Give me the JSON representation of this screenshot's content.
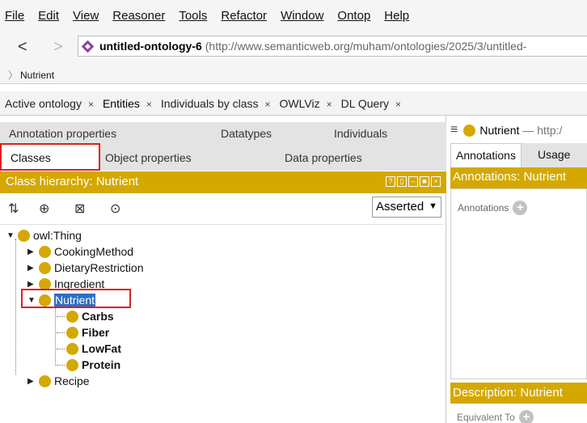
{
  "menu": [
    "File",
    "Edit",
    "View",
    "Reasoner",
    "Tools",
    "Refactor",
    "Window",
    "Ontop",
    "Help"
  ],
  "nav": {
    "back": "<",
    "forward": ">",
    "ontology_name": "untitled-ontology-6",
    "ontology_iri": "(http://www.semanticweb.org/muham/ontologies/2025/3/untitled-",
    "breadcrumb": "Nutrient"
  },
  "tabs": [
    {
      "label": "Active ontology",
      "close": "×"
    },
    {
      "label": "Entities",
      "close": "×"
    },
    {
      "label": "Individuals by class",
      "close": "×"
    },
    {
      "label": "OWLViz",
      "close": "×"
    },
    {
      "label": "DL Query",
      "close": "×"
    }
  ],
  "subtabs": {
    "annotation_properties": "Annotation properties",
    "datatypes": "Datatypes",
    "individuals": "Individuals",
    "classes": "Classes",
    "object_properties": "Object properties",
    "data_properties": "Data properties"
  },
  "hierarchy": {
    "title": "Class hierarchy: Nutrient",
    "mode": "Asserted",
    "nodes": {
      "root": "owl:Thing",
      "cooking": "CookingMethod",
      "dietary": "DietaryRestriction",
      "ingredient": "Ingredient",
      "nutrient": "Nutrient",
      "carbs": "Carbs",
      "fiber": "Fiber",
      "lowfat": "LowFat",
      "protein": "Protein",
      "recipe": "Recipe"
    }
  },
  "right_panel": {
    "entity": "Nutrient",
    "entity_iri": "— http:/",
    "tab_annotations": "Annotations",
    "tab_usage": "Usage",
    "annotations_header": "Annotations: Nutrient",
    "annotations_label": "Annotations",
    "description_header": "Description: Nutrient",
    "equivalent_to": "Equivalent To"
  },
  "colors": {
    "accent": "#d4a800",
    "selection": "#2c6fc7",
    "highlight_box": "#e0201b"
  }
}
